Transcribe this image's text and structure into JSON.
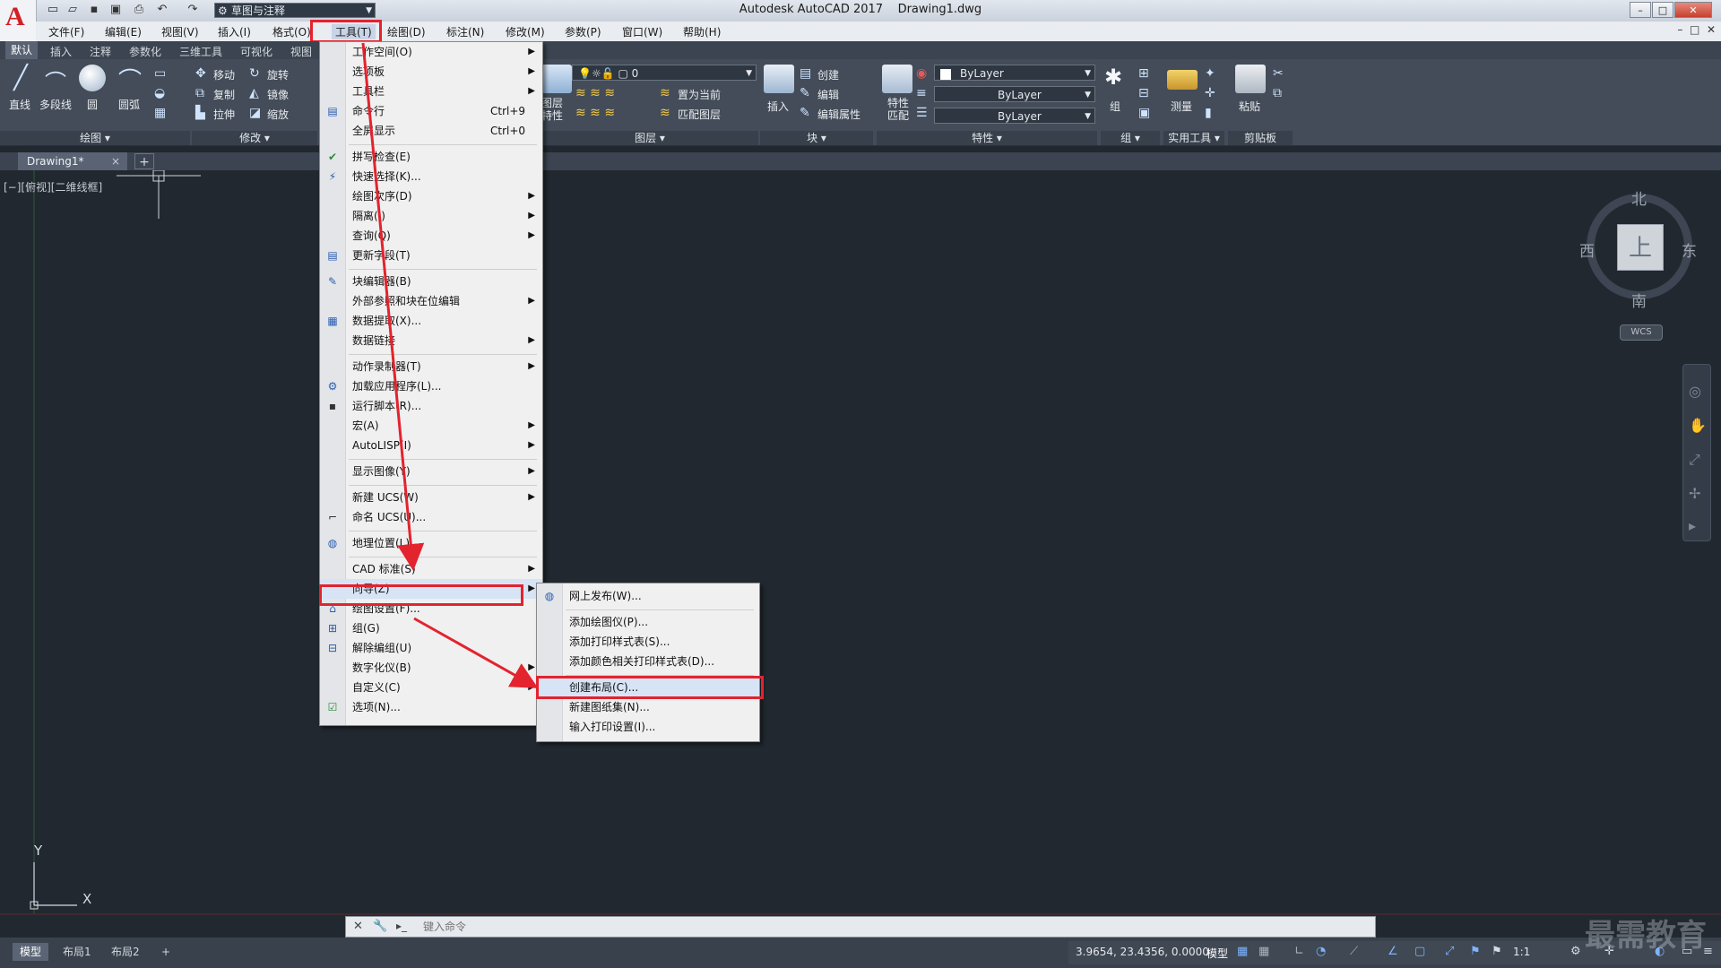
{
  "window": {
    "app_title": "Autodesk AutoCAD 2017",
    "file_name": "Drawing1.dwg",
    "workspace": "草图与注释",
    "logo_letter": "A"
  },
  "menubar": [
    "文件(F)",
    "编辑(E)",
    "视图(V)",
    "插入(I)",
    "格式(O)",
    "工具(T)",
    "绘图(D)",
    "标注(N)",
    "修改(M)",
    "参数(P)",
    "窗口(W)",
    "帮助(H)"
  ],
  "ribbon_tabs": [
    "默认",
    "插入",
    "注释",
    "参数化",
    "三维工具",
    "可视化",
    "视图"
  ],
  "ribbon": {
    "draw": {
      "title": "绘图",
      "line": "直线",
      "polyline": "多段线",
      "circle": "圆",
      "arc": "圆弧"
    },
    "modify": {
      "title": "修改",
      "move": "移动",
      "rotate": "旋转",
      "copy": "复制",
      "mirror": "镜像",
      "stretch": "拉伸",
      "scale": "缩放"
    },
    "layers": {
      "title": "图层",
      "props": "图层特性",
      "current_layer": "0",
      "set_current": "置为当前",
      "match_layer": "匹配图层"
    },
    "block": {
      "title": "块",
      "insert": "插入",
      "create": "创建",
      "edit": "编辑",
      "edit_attr": "编辑属性"
    },
    "properties": {
      "title": "特性",
      "match": "特性匹配",
      "color": "ByLayer",
      "linetype": "ByLayer",
      "lineweight": "ByLayer"
    },
    "groups": {
      "title": "组",
      "group": "组"
    },
    "utilities": {
      "title": "实用工具",
      "measure": "测量"
    },
    "clipboard": {
      "title": "剪贴板",
      "paste": "粘贴"
    }
  },
  "doc_tab": {
    "label": "Drawing1*",
    "close": "×",
    "new": "+"
  },
  "viewport": {
    "label": "[−][俯视][二维线框]"
  },
  "viewcube": {
    "north": "北",
    "south": "南",
    "east": "东",
    "west": "西",
    "face": "上",
    "wcs": "WCS"
  },
  "ucs": {
    "x": "X",
    "y": "Y"
  },
  "command": {
    "placeholder": "键入命令"
  },
  "layout_tabs": [
    "模型",
    "布局1",
    "布局2",
    "+"
  ],
  "status": {
    "coords": "3.9654, 23.4356, 0.0000",
    "model": "模型",
    "scale": "1:1"
  },
  "watermark": "最需教育",
  "tools_menu": {
    "items": [
      {
        "label": "工作空间(O)",
        "arrow": true
      },
      {
        "label": "选项板",
        "arrow": true
      },
      {
        "label": "工具栏",
        "arrow": true
      },
      {
        "label": "命令行",
        "shortcut": "Ctrl+9"
      },
      {
        "label": "全屏显示",
        "shortcut": "Ctrl+0"
      },
      {
        "label": "拼写检查(E)"
      },
      {
        "label": "快速选择(K)..."
      },
      {
        "label": "绘图次序(D)",
        "arrow": true
      },
      {
        "label": "隔离(I)",
        "arrow": true
      },
      {
        "label": "查询(Q)",
        "arrow": true
      },
      {
        "label": "更新字段(T)"
      },
      {
        "label": "块编辑器(B)"
      },
      {
        "label": "外部参照和块在位编辑",
        "arrow": true
      },
      {
        "label": "数据提取(X)..."
      },
      {
        "label": "数据链接",
        "arrow": true
      },
      {
        "label": "动作录制器(T)",
        "arrow": true
      },
      {
        "label": "加载应用程序(L)..."
      },
      {
        "label": "运行脚本(R)..."
      },
      {
        "label": "宏(A)",
        "arrow": true
      },
      {
        "label": "AutoLISP(I)",
        "arrow": true
      },
      {
        "label": "显示图像(Y)",
        "arrow": true
      },
      {
        "label": "新建 UCS(W)",
        "arrow": true
      },
      {
        "label": "命名 UCS(U)..."
      },
      {
        "label": "地理位置(L)..."
      },
      {
        "label": "CAD 标准(S)",
        "arrow": true
      },
      {
        "label": "向导(Z)",
        "arrow": true
      },
      {
        "label": "绘图设置(F)..."
      },
      {
        "label": "组(G)"
      },
      {
        "label": "解除编组(U)"
      },
      {
        "label": "数字化仪(B)",
        "arrow": true
      },
      {
        "label": "自定义(C)",
        "arrow": true
      },
      {
        "label": "选项(N)..."
      }
    ]
  },
  "wizard_menu": {
    "items": [
      "网上发布(W)...",
      "添加绘图仪(P)...",
      "添加打印样式表(S)...",
      "添加颜色相关打印样式表(D)...",
      "创建布局(C)...",
      "新建图纸集(N)...",
      "输入打印设置(I)..."
    ]
  },
  "colors": {
    "highlight": "#e3232e",
    "viewport_bg": "#212830",
    "ribbon_bg": "#434c58"
  }
}
